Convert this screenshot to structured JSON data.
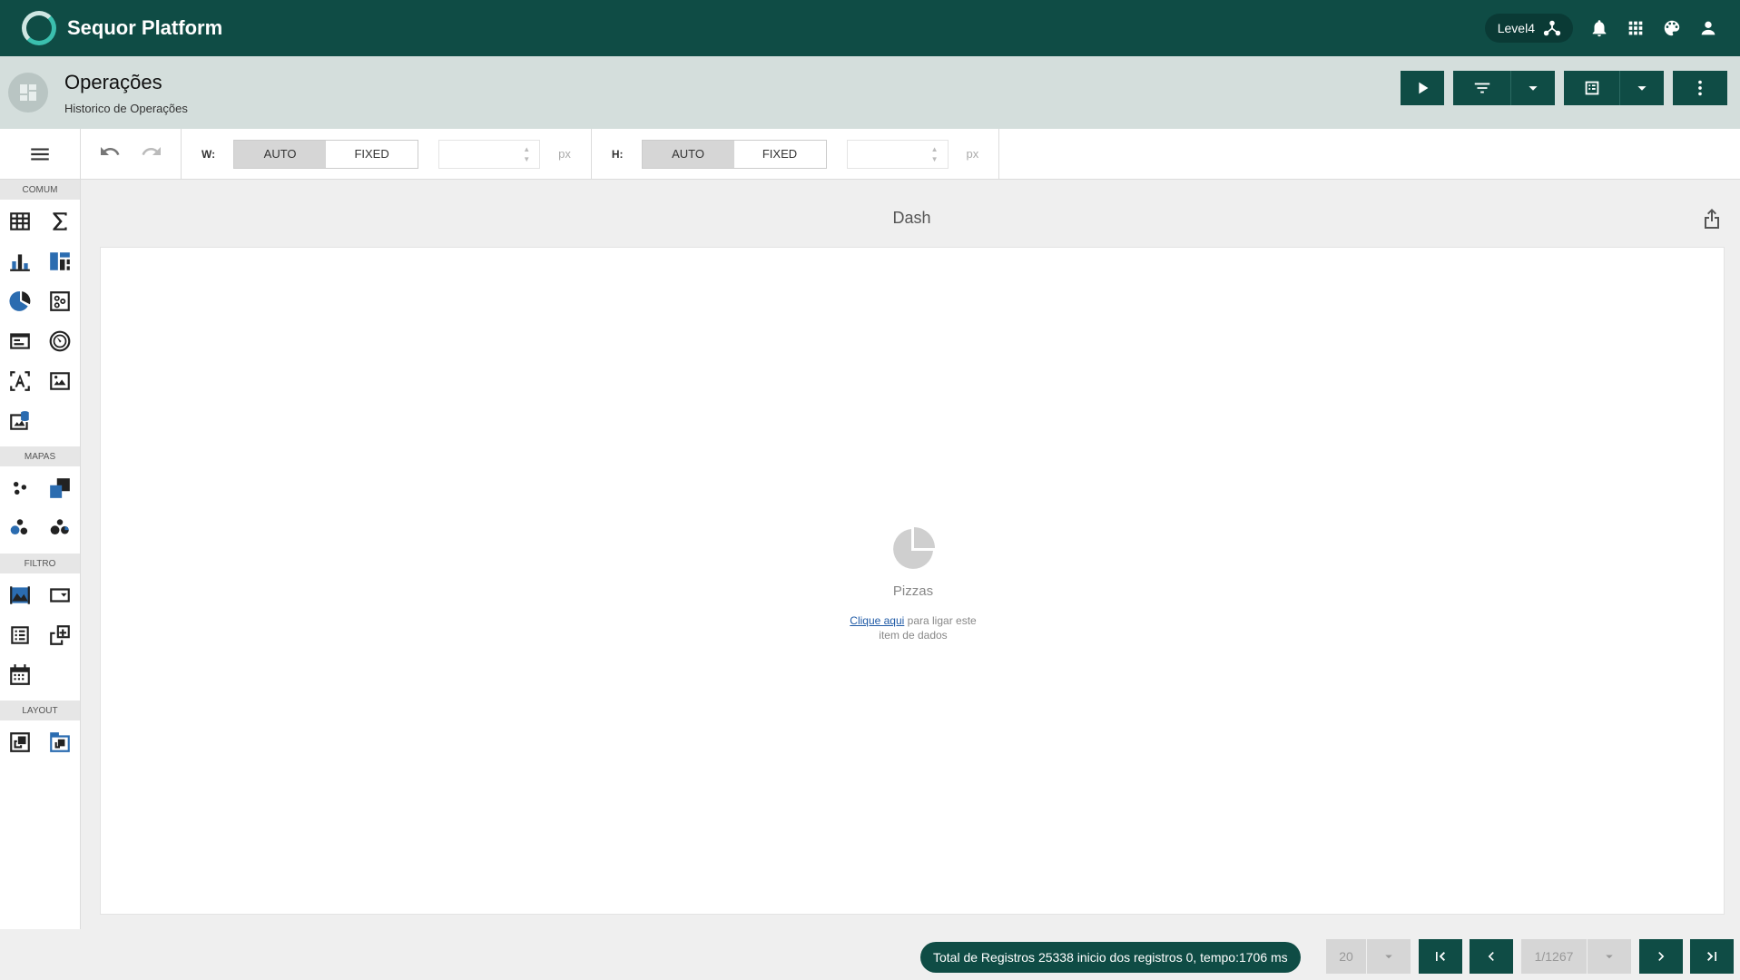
{
  "app": {
    "brand": "Sequor Platform",
    "level_label": "Level4"
  },
  "page": {
    "title": "Operações",
    "subtitle": "Historico de Operações"
  },
  "toolbar": {
    "width_label": "W:",
    "height_label": "H:",
    "auto_label": "AUTO",
    "fixed_label": "FIXED",
    "unit": "px",
    "mode_selected": "AUTO"
  },
  "sidebar": {
    "sections": [
      "COMUM",
      "MAPAS",
      "FILTRO",
      "LAYOUT"
    ]
  },
  "dashboard": {
    "title": "Dash",
    "item_name": "Pizzas",
    "hint_link": "Clique aqui",
    "hint_line1": " para ligar este",
    "hint_line2": "item de dados"
  },
  "footer": {
    "total_text": "Total de Registros 25338 inicio dos registros 0, tempo:1706 ms",
    "page_size": "20",
    "page_indicator": "1/1267"
  },
  "colors": {
    "primary": "#0f4c45",
    "chart_blue": "#2b6cb0"
  }
}
